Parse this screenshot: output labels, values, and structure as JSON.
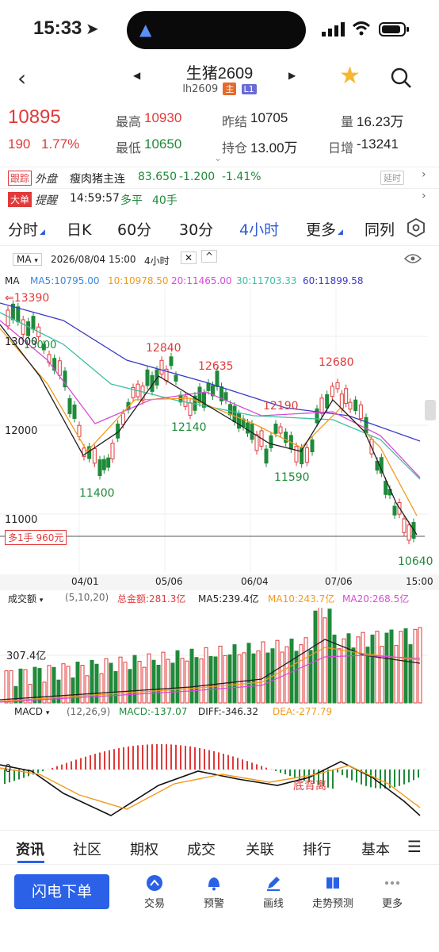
{
  "status_bar": {
    "time": "15:33"
  },
  "header": {
    "title": "生猪2609",
    "code": "lh2609",
    "tag_main": "主",
    "tag_level": "L1"
  },
  "quote": {
    "price": "10895",
    "change": "190",
    "change_pct": "1.77%",
    "high_label": "最高",
    "high": "10930",
    "low_label": "最低",
    "low": "10650",
    "prev_settle_label": "昨结",
    "prev_settle": "10705",
    "open_interest_label": "持仓",
    "open_interest": "13.00万",
    "volume_label": "量",
    "volume": "16.23万",
    "daily_change_label": "日增",
    "daily_change": "-13241"
  },
  "external": {
    "badge": "跟踪",
    "label": "外盘",
    "name": "瘦肉猪主连",
    "price": "83.650",
    "change": "-1.200",
    "change_pct": "-1.41%",
    "delay": "延时"
  },
  "alert": {
    "badge": "大单",
    "label": "提醒",
    "time": "14:59:57",
    "action": "多平",
    "qty": "40手"
  },
  "tabs": [
    "分时",
    "日K",
    "60分",
    "30分",
    "4小时",
    "更多",
    "同列"
  ],
  "active_tab": "4小时",
  "chart_header": {
    "indicator": "MA",
    "date": "2026/08/04 15:00",
    "period": "4小时",
    "ma_label": "MA",
    "ma5": "MA5:10795.00",
    "ma10": "10:10978.50",
    "ma20": "20:11465.00",
    "ma30": "30:11703.33",
    "ma60": "60:11899.58"
  },
  "price_axis": [
    "13000",
    "12000",
    "11000"
  ],
  "date_axis": [
    "04/01",
    "05/06",
    "06/04",
    "07/06",
    "15:00"
  ],
  "annotations": [
    "13390",
    "13000",
    "12840",
    "12635",
    "12680",
    "12190",
    "12140",
    "11590",
    "11400",
    "10640"
  ],
  "position_label": "多1手 960元",
  "volume_header": {
    "label": "成交额",
    "params": "(5,10,20)",
    "total": "总金额:281.3亿",
    "ma5": "MA5:239.4亿",
    "ma10": "MA10:243.7亿",
    "ma20": "MA20:268.5亿",
    "axis": "307.4亿"
  },
  "macd_header": {
    "label": "MACD",
    "params": "(12,26,9)",
    "macd": "MACD:-137.07",
    "diff": "DIFF:-346.32",
    "dea": "DEA:-277.79",
    "zero": "0",
    "divergence": "底背离"
  },
  "bottom_tabs": [
    "资讯",
    "社区",
    "期权",
    "成交",
    "关联",
    "排行",
    "基本"
  ],
  "dock": {
    "trade": "闪电下单",
    "items": [
      "交易",
      "预警",
      "画线",
      "走势预测",
      "更多"
    ]
  },
  "colors": {
    "up": "#e03a3a",
    "down": "#1f8a3a",
    "accent": "#2b61e6",
    "ma5": "#1f1f1f",
    "ma10": "#f29a1c",
    "ma20": "#d64bd6",
    "ma30": "#3bbfa5",
    "ma60": "#3a3ac8"
  }
}
